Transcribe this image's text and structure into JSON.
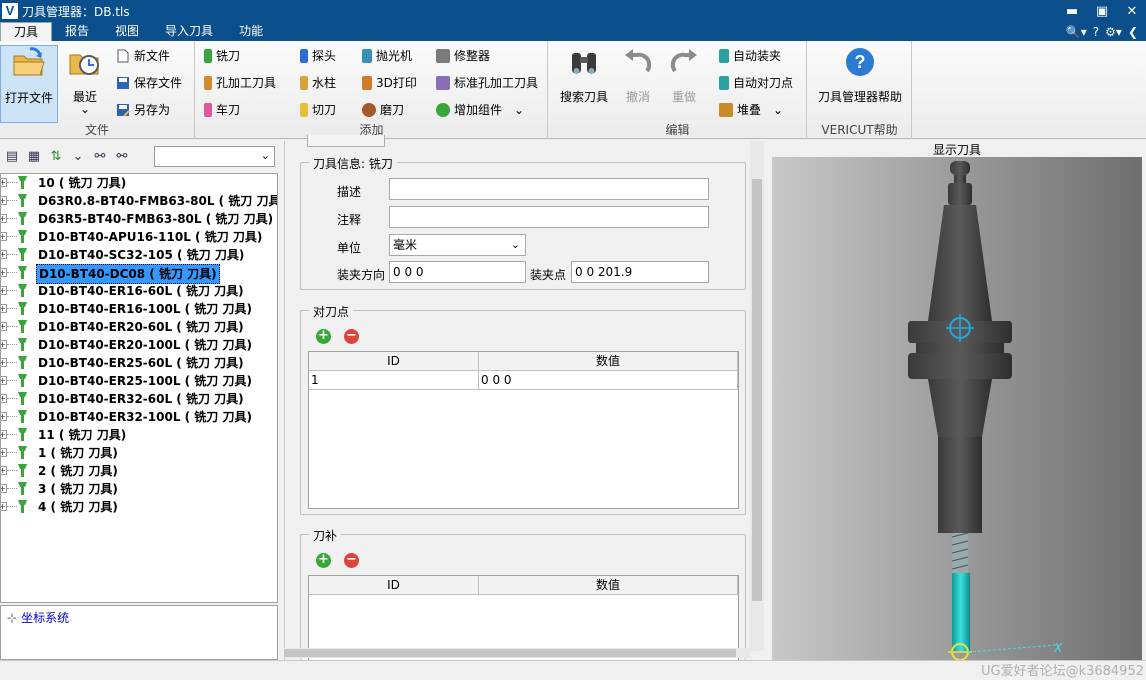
{
  "window": {
    "title": "刀具管理器：DB.tls",
    "app_icon": "V",
    "minimize": "▬",
    "maximize": "▣",
    "close": "✕"
  },
  "menu": {
    "tabs": [
      "刀具",
      "报告",
      "视图",
      "导入刀具",
      "功能"
    ],
    "active_tab": "刀具",
    "right_icons": [
      "search-icon",
      "help-icon",
      "gear-icon",
      "expand-icon"
    ],
    "right_glyphs": [
      "🔍▾",
      "?",
      "⚙▾",
      "❮"
    ]
  },
  "ribbon": {
    "file": {
      "label": "文件",
      "open": "打开文件",
      "recent": "最近",
      "recent_arrow": "⌄",
      "new": "新文件",
      "save": "保存文件",
      "save_as": "另存为"
    },
    "add": {
      "label": "添加",
      "mill": "铣刀",
      "hole_tool": "孔加工刀具",
      "turning": "车刀",
      "probe": "探头",
      "water_jet": "水柱",
      "cut": "切刀",
      "polisher": "抛光机",
      "print3d": "3D打印",
      "grinder": "磨刀",
      "dresser": "修整器",
      "std_hole": "标准孔加工刀具",
      "add_component": "增加组件",
      "add_component_arrow": "⌄"
    },
    "edit": {
      "label": "编辑",
      "search": "搜索刀具",
      "undo": "撤消",
      "redo": "重做",
      "auto_mount": "自动装夹",
      "auto_align": "自动对刀点",
      "stack": "堆叠",
      "stack_arrow": "⌄"
    },
    "help": {
      "label": "VERICUT帮助",
      "manager_help": "刀具管理器帮助"
    }
  },
  "tree": {
    "search_value": "",
    "items": [
      "10 ( 铣刀 刀具)",
      "D63R0.8-BT40-FMB63-80L ( 铣刀 刀具)",
      "D63R5-BT40-FMB63-80L ( 铣刀 刀具)",
      "D10-BT40-APU16-110L ( 铣刀 刀具)",
      "D10-BT40-SC32-105 ( 铣刀 刀具)",
      "D10-BT40-DC08 ( 铣刀 刀具)",
      "D10-BT40-ER16-60L ( 铣刀 刀具)",
      "D10-BT40-ER16-100L ( 铣刀 刀具)",
      "D10-BT40-ER20-60L ( 铣刀 刀具)",
      "D10-BT40-ER20-100L ( 铣刀 刀具)",
      "D10-BT40-ER25-60L ( 铣刀 刀具)",
      "D10-BT40-ER25-100L ( 铣刀 刀具)",
      "D10-BT40-ER32-60L ( 铣刀 刀具)",
      "D10-BT40-ER32-100L ( 铣刀 刀具)",
      "11 ( 铣刀 刀具)",
      "1 ( 铣刀 刀具)",
      "2 ( 铣刀 刀具)",
      "3 ( 铣刀 刀具)",
      "4 ( 铣刀 刀具)"
    ],
    "selected_index": 5,
    "coord_system": "坐标系统"
  },
  "tool_info": {
    "legend": "刀具信息: 铣刀",
    "desc_label": "描述",
    "desc_value": "",
    "note_label": "注释",
    "note_value": "",
    "unit_label": "单位",
    "unit_value": "毫米",
    "clamp_dir_label": "装夹方向",
    "clamp_dir_value": "0 0 0",
    "clamp_pt_label": "装夹点",
    "clamp_pt_value": "0 0 201.9"
  },
  "align_points": {
    "legend": "对刀点",
    "headers": [
      "ID",
      "数值"
    ],
    "rows": [
      [
        "1",
        "0 0 0"
      ]
    ]
  },
  "comp": {
    "legend": "刀补",
    "headers": [
      "ID",
      "数值"
    ]
  },
  "viewer": {
    "title": "显示刀具",
    "axis_x": "X",
    "watermark": "UG爱好者论坛@k3684952"
  },
  "colors": {
    "titlebar": "#0a4f8c",
    "selection": "#3399ff",
    "tool_gray": "#4a4a4a",
    "tool_cyan": "#22c8c8",
    "add_green": "#3aa63a",
    "remove_red": "#d9453b"
  }
}
